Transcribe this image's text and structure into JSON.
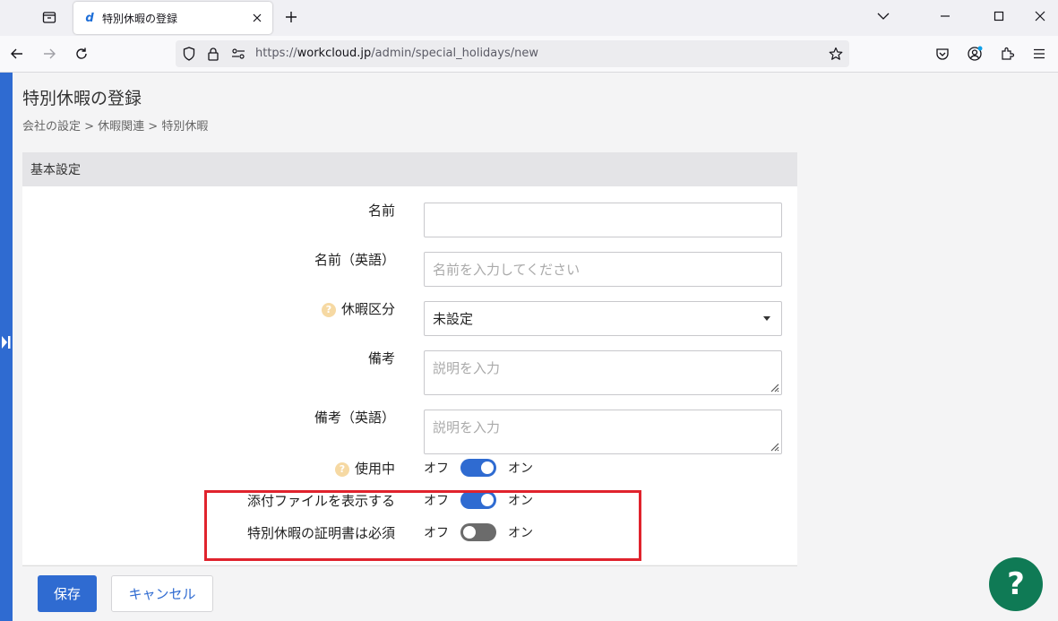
{
  "browser": {
    "tab_title": "特別休暇の登録",
    "tab_favicon": "d",
    "url_prefix": "https://",
    "url_host": "workcloud.jp",
    "url_path": "/admin/special_holidays/new"
  },
  "page": {
    "title": "特別休暇の登録",
    "breadcrumb": "会社の設定 > 休暇関連 > 特別休暇"
  },
  "form": {
    "section_title": "基本設定",
    "name_label": "名前",
    "name_value": "",
    "name_en_label": "名前（英語）",
    "name_en_placeholder": "名前を入力してください",
    "category_label": "休暇区分",
    "category_value": "未設定",
    "note_label": "備考",
    "note_placeholder": "説明を入力",
    "note_en_label": "備考（英語）",
    "note_en_placeholder": "説明を入力",
    "help_glyph": "?",
    "toggles": [
      {
        "label": "使用中",
        "off": "オフ",
        "on": "オン",
        "state": true
      },
      {
        "label": "添付ファイルを表示する",
        "off": "オフ",
        "on": "オン",
        "state": true
      },
      {
        "label": "特別休暇の証明書は必須",
        "off": "オフ",
        "on": "オン",
        "state": false
      }
    ]
  },
  "footer": {
    "save_label": "保存",
    "cancel_label": "キャンセル"
  },
  "help_fab": "?",
  "colors": {
    "accent": "#2f6bd1",
    "highlight": "#e0232d",
    "help": "#0f7a55"
  }
}
